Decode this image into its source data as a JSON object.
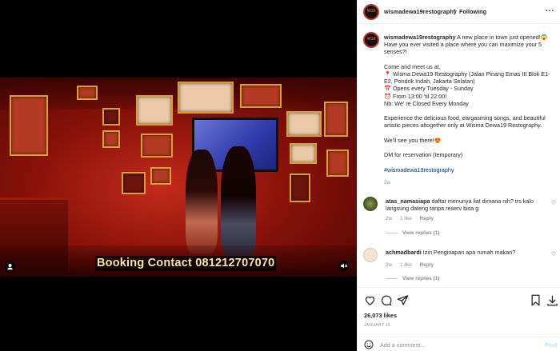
{
  "media": {
    "overlay_text": "Booking Contact 081212707070"
  },
  "post": {
    "username": "wismadewa19restography",
    "dot": "•",
    "follow_label": "Following",
    "more": "...",
    "caption": "A new place in town just opened!😱 Have you ever visited a place where you can maximize your 5 senses?!\n\nCome and meet us at,\n📍 Wisma Dewa19 Restography (Jalan Pinang Emas III Blok E1-E2, Pondok Indah, Jakarta Selatan)\n📅 Opens every Tuesday - Sunday\n⏰ From 13:00 'til 22:00!\nNb: We' re Closed Every Monday\n\nExperience the delicious food, eargasming songs, and beautiful artistic pieces altogether only at Wisma Dewa19 Restography.\n\nWe'll see you there!😍\n\nDM for reservation (temporary)\n\n",
    "hashtag": "#wismadewa19restography",
    "caption_time": "2w"
  },
  "comments": [
    {
      "username": "atas_namasiapa",
      "text": "daftar menunya liat dimana nih? trs kalo langsung dateng tanpa reserv bisa g",
      "time": "2w",
      "likes": "1 like",
      "reply": "Reply",
      "view_replies": "View replies (1)",
      "avatar_color": "#4a5a2a"
    },
    {
      "username": "achmadbardi",
      "text": "Izin Penginapan apa rumah makan?",
      "time": "2w",
      "likes": "1 like",
      "reply": "Reply",
      "view_replies": "View replies (1)",
      "avatar_color": "#e8dcc8"
    }
  ],
  "footer": {
    "likes": "26,073 likes",
    "date": "JANUARY 15",
    "add_comment_placeholder": "Add a comment...",
    "post_label": "Post"
  },
  "icons": {
    "like": "heart-icon",
    "comment": "comment-icon",
    "share": "share-icon",
    "save": "bookmark-icon",
    "download": "download-icon",
    "emoji": "smiley-icon",
    "tagged_users": "user-icon",
    "mute": "mute-icon"
  },
  "colors": {
    "accent": "#0095f6",
    "link": "#00376b",
    "muted": "#8e8e8e",
    "post_disabled": "#b2dffc",
    "overlay_text": "#f4e7a8"
  }
}
